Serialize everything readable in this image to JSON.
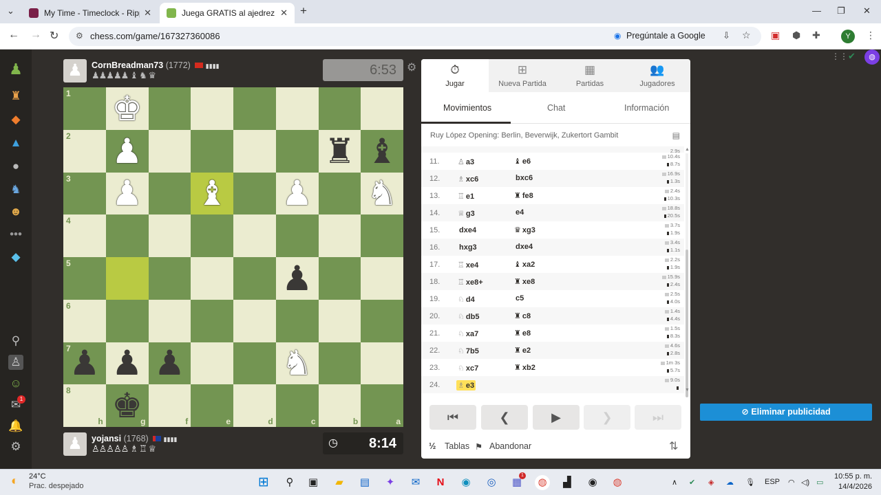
{
  "browser": {
    "tabs": [
      {
        "title": "My Time - Timeclock - Rippling",
        "active": false
      },
      {
        "title": "Juega GRATIS al ajedrez online",
        "active": true
      }
    ],
    "url": "chess.com/game/167327360086",
    "ask_google": "Pregúntale a Google",
    "profile_initial": "Y"
  },
  "game": {
    "top_player": {
      "name": "CornBreadman73",
      "rating": "(1772)",
      "captured": "♟♟♟♟♟ ♝ ♞ ♛",
      "clock": "6:53"
    },
    "bottom_player": {
      "name": "yojansi",
      "rating": "(1768)",
      "captured": "♙♙♙♙♙ ♗ ♖ ♕",
      "clock": "8:14"
    },
    "board": {
      "ranks": [
        "1",
        "2",
        "3",
        "4",
        "5",
        "6",
        "7",
        "8"
      ],
      "files": [
        "h",
        "g",
        "f",
        "e",
        "d",
        "c",
        "b",
        "a"
      ]
    }
  },
  "panel": {
    "tabs": [
      {
        "label": "Jugar",
        "icon": "stopwatch-icon"
      },
      {
        "label": "Nueva Partida",
        "icon": "plus-icon"
      },
      {
        "label": "Partidas",
        "icon": "grid-icon"
      },
      {
        "label": "Jugadores",
        "icon": "users-icon"
      }
    ],
    "subtabs": [
      "Movimientos",
      "Chat",
      "Información"
    ],
    "opening": "Ruy López Opening: Berlin, Beverwijk, Zukertort Gambit",
    "moves": [
      {
        "num": "11.",
        "wfig": "♙",
        "white": "a3",
        "bfig": "♝",
        "black": "e6",
        "t1": "10.4s",
        "t2": "8.7s"
      },
      {
        "num": "12.",
        "wfig": "♗",
        "white": "xc6",
        "bfig": "",
        "black": "bxc6",
        "t1": "16.9s",
        "t2": "1.3s"
      },
      {
        "num": "13.",
        "wfig": "♖",
        "white": "e1",
        "bfig": "♜",
        "black": "fe8",
        "t1": "2.4s",
        "t2": "10.3s"
      },
      {
        "num": "14.",
        "wfig": "♕",
        "white": "g3",
        "bfig": "",
        "black": "e4",
        "t1": "18.8s",
        "t2": "20.5s"
      },
      {
        "num": "15.",
        "wfig": "",
        "white": "dxe4",
        "bfig": "♛",
        "black": "xg3",
        "t1": "3.7s",
        "t2": "1.9s"
      },
      {
        "num": "16.",
        "wfig": "",
        "white": "hxg3",
        "bfig": "",
        "black": "dxe4",
        "t1": "3.4s",
        "t2": "1.1s"
      },
      {
        "num": "17.",
        "wfig": "♖",
        "white": "xe4",
        "bfig": "♝",
        "black": "xa2",
        "t1": "2.2s",
        "t2": "1.9s"
      },
      {
        "num": "18.",
        "wfig": "♖",
        "white": "xe8+",
        "bfig": "♜",
        "black": "xe8",
        "t1": "15.9s",
        "t2": "2.4s"
      },
      {
        "num": "19.",
        "wfig": "♘",
        "white": "d4",
        "bfig": "",
        "black": "c5",
        "t1": "2.5s",
        "t2": "4.0s"
      },
      {
        "num": "20.",
        "wfig": "♘",
        "white": "db5",
        "bfig": "♜",
        "black": "c8",
        "t1": "1.4s",
        "t2": "4.4s"
      },
      {
        "num": "21.",
        "wfig": "♘",
        "white": "xa7",
        "bfig": "♜",
        "black": "e8",
        "t1": "1.5s",
        "t2": "8.3s"
      },
      {
        "num": "22.",
        "wfig": "♘",
        "white": "7b5",
        "bfig": "♜",
        "black": "e2",
        "t1": "4.6s",
        "t2": "2.8s"
      },
      {
        "num": "23.",
        "wfig": "♘",
        "white": "xc7",
        "bfig": "♜",
        "black": "xb2",
        "t1": "1m 3s",
        "t2": "5.7s"
      },
      {
        "num": "24.",
        "wfig": "♗",
        "white": "e3",
        "bfig": "",
        "black": "",
        "t1": "9.0s",
        "t2": ""
      }
    ],
    "footer": {
      "draw": "Tablas",
      "resign": "Abandonar"
    }
  },
  "ad_button": "Eliminar publicidad",
  "notifications_badge": "1",
  "taskbar": {
    "weather_temp": "24°C",
    "weather_desc": "Prac. despejado",
    "lang": "ESP",
    "time": "10:55 p. m.",
    "date": "14/4/2026"
  }
}
